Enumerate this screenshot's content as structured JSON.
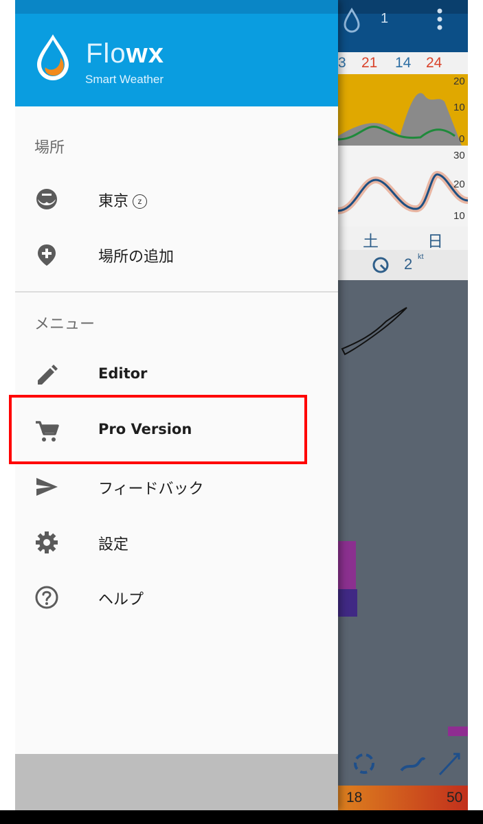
{
  "app": {
    "name_light": "Flo",
    "name_bold": "wx",
    "tagline": "Smart Weather"
  },
  "background_app": {
    "top_counter": "1",
    "hours": [
      "3",
      "21",
      "14",
      "24"
    ],
    "chart1_axis": [
      "20",
      "10",
      "0"
    ],
    "chart2_axis": [
      "30",
      "20",
      "10"
    ],
    "days": [
      "土",
      "日"
    ],
    "wind_value": "2",
    "wind_unit": "kt",
    "scale_labels": [
      "18",
      "50"
    ]
  },
  "drawer": {
    "locations_title": "場所",
    "locations": [
      {
        "label": "東京",
        "badge": "z",
        "icon": "noaa-globe-icon"
      },
      {
        "label": "場所の追加",
        "icon": "add-location-icon"
      }
    ],
    "menu_title": "メニュー",
    "menu": [
      {
        "label": "Editor",
        "icon": "pencil-icon"
      },
      {
        "label": "Pro Version",
        "icon": "cart-icon"
      },
      {
        "label": "フィードバック",
        "icon": "send-icon"
      },
      {
        "label": "設定",
        "icon": "gear-icon"
      },
      {
        "label": "ヘルプ",
        "icon": "help-circle-icon"
      }
    ]
  },
  "colors": {
    "header_blue": "#0a9de0",
    "highlight": "#ff0000",
    "icon_gray": "#5b5b5b"
  }
}
